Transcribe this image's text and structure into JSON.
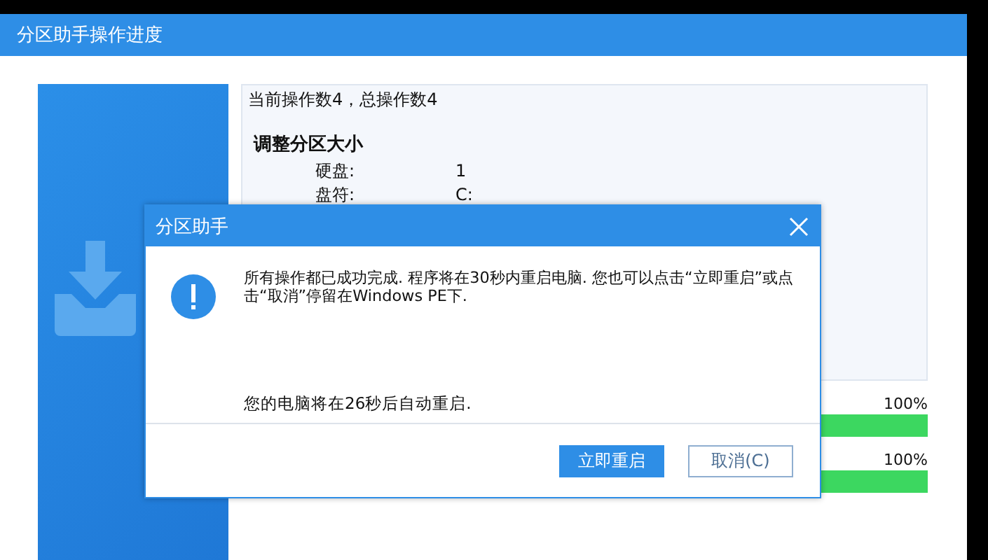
{
  "window": {
    "title": "分区助手操作进度"
  },
  "log": {
    "summary": "当前操作数4，总操作数4",
    "operation": "调整分区大小",
    "fields": [
      {
        "label": "硬盘:",
        "value": "1"
      },
      {
        "label": "盘符:",
        "value": "C:"
      }
    ]
  },
  "progress": [
    {
      "reading": "100%",
      "level": 1
    },
    {
      "reading": "100%",
      "level": 1
    }
  ],
  "dialog": {
    "title": "分区助手",
    "message": "所有操作都已成功完成. 程序将在30秒内重启电脑. 您也可以点击“立即重启”或点击“取消”停留在Windows PE下.",
    "countdown": "您的电脑将在26秒后自动重启.",
    "buttons": [
      {
        "label": "立即重启",
        "kind": "primary"
      },
      {
        "label": "取消(C)",
        "kind": "secondary"
      }
    ]
  }
}
